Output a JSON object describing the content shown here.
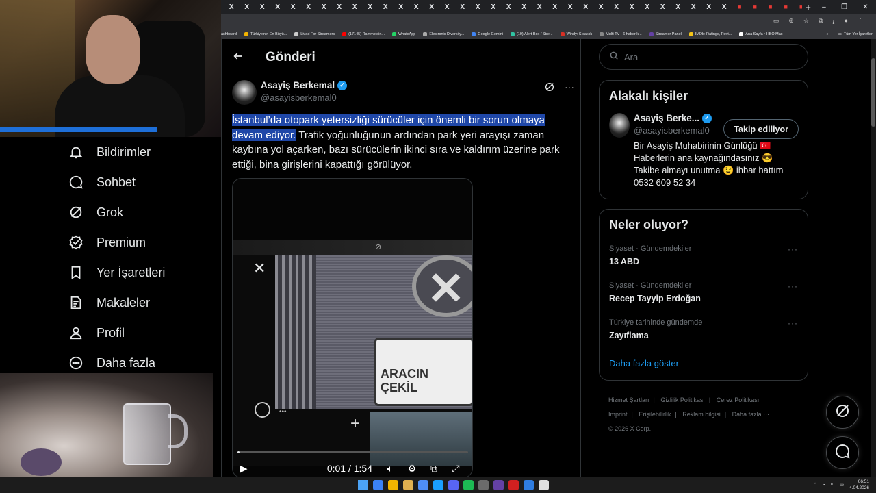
{
  "browser": {
    "tabs_count": 38,
    "new_tab_label": "+",
    "tab_glyph": "X",
    "bookmarks": [
      {
        "label": "ashboard",
        "color": "#ffffff"
      },
      {
        "label": "Türkiye'nin En Büyü...",
        "color": "#f4b400"
      },
      {
        "label": "Livad For Streamers",
        "color": "#cccccc"
      },
      {
        "label": "(17145) Rammstein...",
        "color": "#ff0000"
      },
      {
        "label": "WhatsApp",
        "color": "#25d366"
      },
      {
        "label": "Electronic Diversity...",
        "color": "#aaaaaa"
      },
      {
        "label": "Google Gemini",
        "color": "#4285f4"
      },
      {
        "label": "(19) Alert Box / Stre...",
        "color": "#31c3a2"
      },
      {
        "label": "Windy: Sıcaklık",
        "color": "#d93025"
      },
      {
        "label": "Multi TV - 6 haber k...",
        "color": "#888888"
      },
      {
        "label": "Streamer Panel",
        "color": "#6441a5"
      },
      {
        "label": "IMDb: Ratings, Revi...",
        "color": "#f5c518"
      },
      {
        "label": "Ana Sayfa • HBO Max",
        "color": "#ffffff"
      }
    ],
    "bookmarks_overflow": "»",
    "all_bookmarks": "Tüm Yer İşaretleri"
  },
  "nav": {
    "items": [
      {
        "label": "Bildirimler",
        "icon": "bell-icon"
      },
      {
        "label": "Sohbet",
        "icon": "chat-icon"
      },
      {
        "label": "Grok",
        "icon": "grok-icon"
      },
      {
        "label": "Premium",
        "icon": "premium-badge-icon"
      },
      {
        "label": "Yer İşaretleri",
        "icon": "bookmark-icon"
      },
      {
        "label": "Makaleler",
        "icon": "article-icon"
      },
      {
        "label": "Profil",
        "icon": "profile-icon"
      },
      {
        "label": "Daha fazla",
        "icon": "more-circle-icon"
      }
    ],
    "notification_badge": "+"
  },
  "post": {
    "header_title": "Gönderi",
    "author_name": "Asayiş Berkemal",
    "author_handle": "@asayisberkemal0",
    "text_highlighted": "İstanbul’da otopark yetersizliği sürücüler için önemli bir sorun olmaya devam ediyor.",
    "text_rest": " Trafik yoğunluğunun ardından park yeri arayışı zaman kaybına yol açarken, bazı sürücülerin ikinci sıra ve kaldırım üzerine park ettiği, bina girişlerini kapattığı görülüyor.",
    "video": {
      "current_time": "0:01",
      "duration": "1:54",
      "time_display": "0:01 / 1:54",
      "progress_fraction": 0.01,
      "sign_text_line1": "ARACIN",
      "sign_text_line2": "ÇEKİL"
    }
  },
  "sidebar_right": {
    "search_placeholder": "Ara",
    "related_title": "Alakalı kişiler",
    "related_person": {
      "name": "Asayiş Berke...",
      "handle": "@asayisberkemal0",
      "follow_label": "Takip ediliyor",
      "bio_lines": [
        "Bir Asayiş Muhabirinin Günlüğü 🇹🇷",
        "Haberlerin ana kaynağındasınız 😎",
        "Takibe almayı unutma 😉 ihbar hattım",
        "0532 609 52 34"
      ]
    },
    "trends_title": "Neler oluyor?",
    "trends": [
      {
        "context": "Siyaset · Gündemdekiler",
        "name": "13 ABD"
      },
      {
        "context": "Siyaset · Gündemdekiler",
        "name": "Recep Tayyip Erdoğan"
      },
      {
        "context": "Türkiye tarihinde gündemde",
        "name": "Zayıflama"
      }
    ],
    "show_more": "Daha fazla göster",
    "footer_links": [
      "Hizmet Şartları",
      "Gizlilik Politikası",
      "Çerez Politikası",
      "Imprint",
      "Erişilebilirlik",
      "Reklam bilgisi",
      "Daha fazla ···"
    ],
    "copyright": "© 2026 X Corp."
  },
  "taskbar": {
    "time": "06:51",
    "date": "4.04.2026",
    "apps": [
      "#3b82f6",
      "#f2b400",
      "#e0b050",
      "#4f8ef7",
      "#1a9fff",
      "#5865f2",
      "#1db954",
      "#6b6b6b",
      "#6441a5",
      "#d02020",
      "#2f7de1",
      "#e0e0e0"
    ]
  }
}
